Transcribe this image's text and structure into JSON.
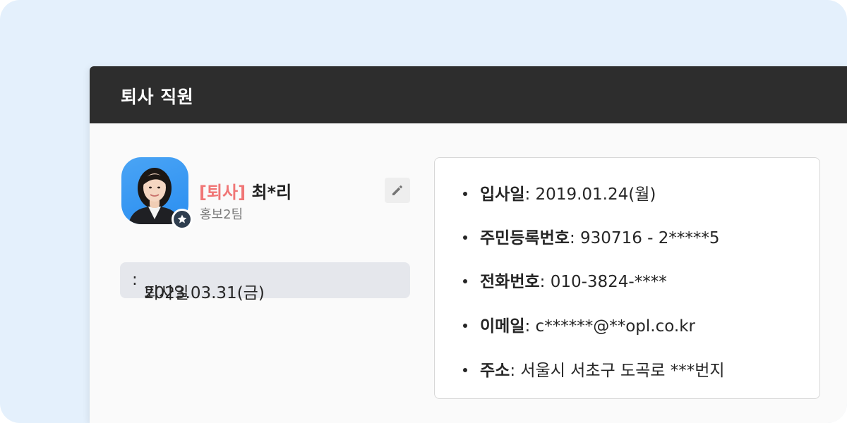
{
  "window": {
    "title": "퇴사 직원"
  },
  "profile": {
    "status_tag": "[퇴사]",
    "name": "최*리",
    "team": "홍보2팀",
    "edit_icon": "pencil-icon",
    "badge_icon": "star-icon"
  },
  "leave": {
    "label": "퇴사일",
    "value": "2023.03.31(금)"
  },
  "details": [
    {
      "label": "입사일",
      "value": "2019.01.24(월)"
    },
    {
      "label": "주민등록번호",
      "value": "930716 - 2*****5"
    },
    {
      "label": "전화번호",
      "value": "010-3824-****"
    },
    {
      "label": "이메일",
      "value": "c******@**opl.co.kr"
    },
    {
      "label": "주소",
      "value": "서울시 서초구 도곡로 ***번지"
    }
  ],
  "colors": {
    "background": "#e4f0fc",
    "titlebar": "#2d2d2d",
    "status_tag": "#f07676",
    "avatar": "#2a8ef0",
    "leave_box": "#e5e7ec"
  }
}
